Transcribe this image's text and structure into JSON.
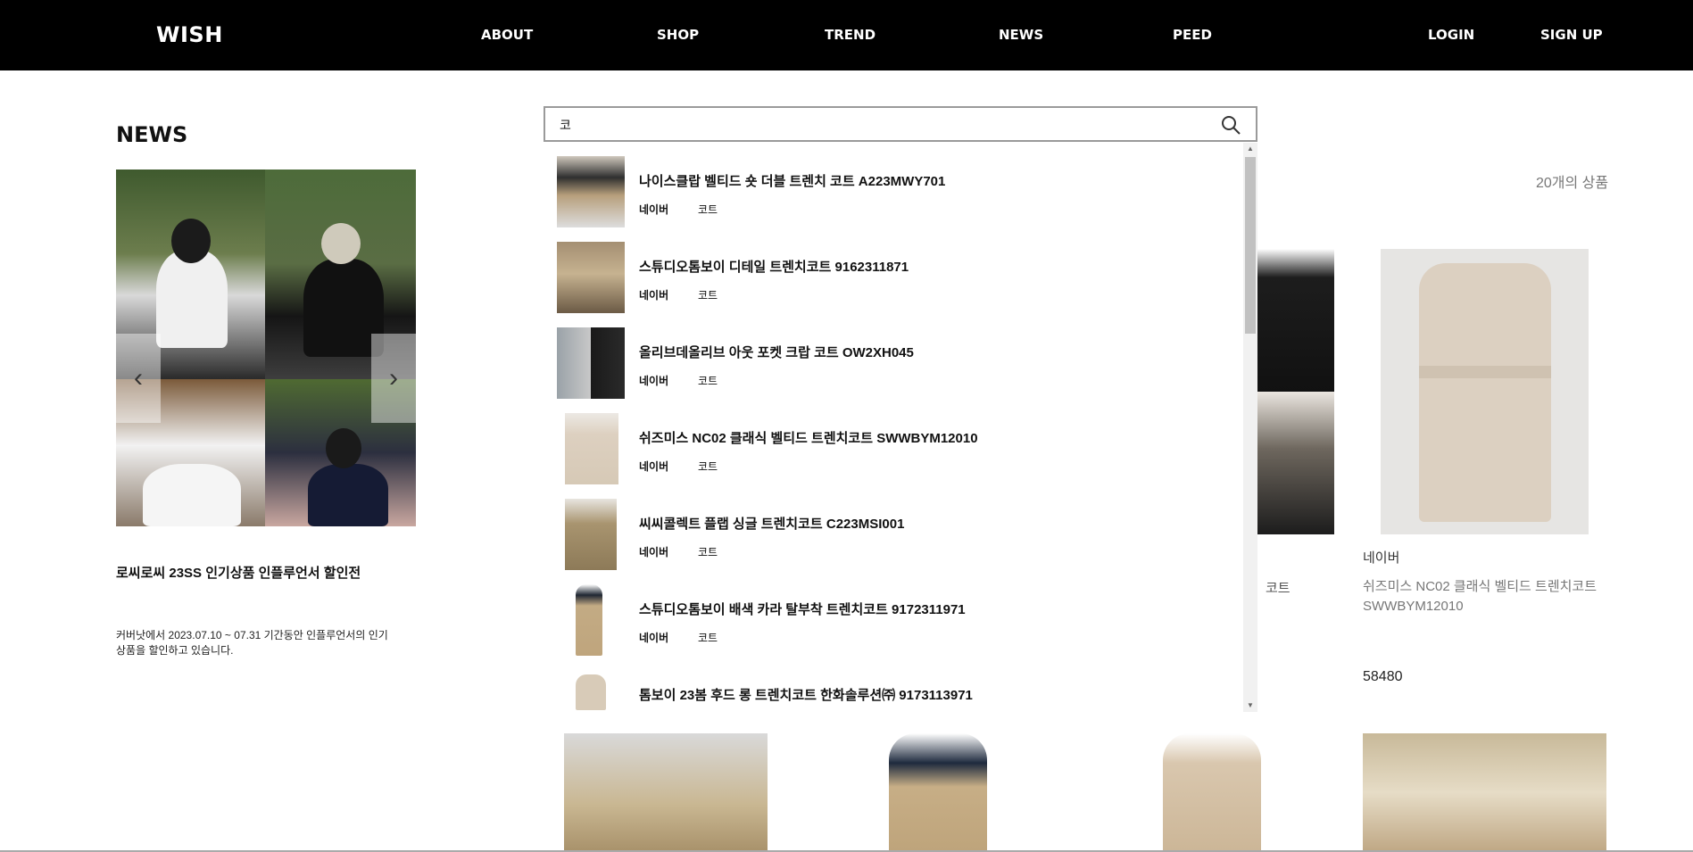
{
  "header": {
    "logo": "WISH",
    "nav": [
      "ABOUT",
      "SHOP",
      "TREND",
      "NEWS",
      "PEED"
    ],
    "login": "LOGIN",
    "signup": "SIGN UP"
  },
  "news": {
    "title": "NEWS",
    "headline": "로씨로씨 23SS 인기상품 인플루언서 할인전",
    "description": "커버낫에서 2023.07.10 ~ 07.31 기간동안 인플루언서의 인기 상품을 할인하고 있습니다.",
    "prev_arrow": "‹",
    "next_arrow": "›"
  },
  "search": {
    "value": "코",
    "results": [
      {
        "title": "나이스클랍 벨티드 숏 더블 트렌치 코트 A223MWY701",
        "brand": "네이버",
        "category": "코트"
      },
      {
        "title": "스튜디오톰보이 디테일 트렌치코트 9162311871",
        "brand": "네이버",
        "category": "코트"
      },
      {
        "title": "올리브데올리브 아웃 포켓 크랍 코트 OW2XH045",
        "brand": "네이버",
        "category": "코트"
      },
      {
        "title": "쉬즈미스 NC02 클래식 벨티드 트렌치코트 SWWBYM12010",
        "brand": "네이버",
        "category": "코트"
      },
      {
        "title": "씨씨콜렉트 플랩 싱글 트렌치코트 C223MSI001",
        "brand": "네이버",
        "category": "코트"
      },
      {
        "title": "스튜디오톰보이 배색 카라 탈부착 트렌치코트 9172311971",
        "brand": "네이버",
        "category": "코트"
      },
      {
        "title": "톰보이 23봄 후드 롱 트렌치코트 한화솔루션㈜ 9173113971",
        "brand": "",
        "category": ""
      }
    ]
  },
  "products": {
    "count": "20개의 상품",
    "partial_name": "코트",
    "featured": {
      "brand": "네이버",
      "name": "쉬즈미스 NC02 클래식 벨티드 트렌치코트 SWWBYM12010",
      "price": "58480"
    }
  },
  "colors": {
    "header_bg": "#000000",
    "accent": "#111111"
  }
}
